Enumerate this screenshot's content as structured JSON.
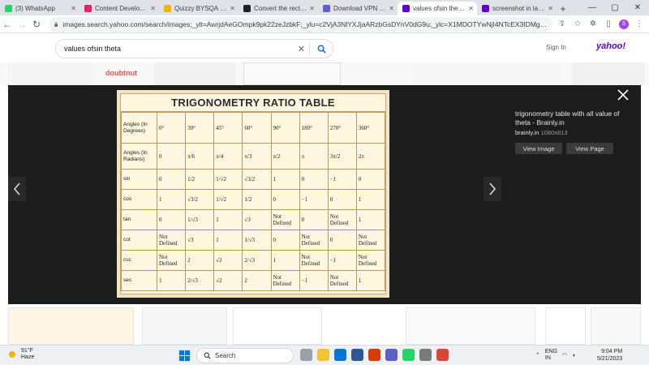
{
  "tabs": [
    {
      "title": "(3) WhatsApp",
      "color": "#25d366"
    },
    {
      "title": "Content Developer te...",
      "color": "#e91e63"
    },
    {
      "title": "Quizzy BYSQA Test Gu...",
      "color": "#f5b400"
    },
    {
      "title": "Convert the rectangul...",
      "color": "#202124"
    },
    {
      "title": "Download VPN | Prot...",
      "color": "#5b5fc7"
    },
    {
      "title": "values ofsin theta - Yo...",
      "color": "#6001d2"
    },
    {
      "title": "screenshot in laptop ...",
      "color": "#6001d2"
    }
  ],
  "browser": {
    "url": "images.search.yahoo.com/search/images;_ylt=AwrjdAeGOmpk9pk22zeJzbkF;_ylu=c2VjA3NlYXJjaARzbGsDYnV0dG9u;_ylc=X1MDOTYwNjI4NTcEX3IDMgRmcmNtYWEEZnlyA3A6cyx2OmksbTpz..."
  },
  "yahoo": {
    "search_query": "values ofsin theta",
    "sign_in": "Sign In",
    "logo": "yahoo!"
  },
  "results": {
    "doubtnut": "doubtnut"
  },
  "viewer": {
    "title": "trigonometry table with all value of theta - Brainly.in",
    "source": "brainly.in",
    "dimensions": "1080x813",
    "view_image": "View Image",
    "view_page": "View Page"
  },
  "trig_table": {
    "heading": "TRIGONOMETRY RATIO TABLE",
    "rows": [
      [
        "Angles (In Degrees)",
        "0°",
        "30°",
        "45°",
        "60°",
        "90°",
        "180°",
        "270°",
        "360°"
      ],
      [
        "Angles (In Radians)",
        "0",
        "π/6",
        "π/4",
        "π/3",
        "π/2",
        "π",
        "3π/2",
        "2π"
      ],
      [
        "sin",
        "0",
        "1/2",
        "1/√2",
        "√3/2",
        "1",
        "0",
        "−1",
        "0"
      ],
      [
        "cos",
        "1",
        "√3/2",
        "1/√2",
        "1/2",
        "0",
        "−1",
        "0",
        "1"
      ],
      [
        "tan",
        "0",
        "1/√3",
        "1",
        "√3",
        "Not Defined",
        "0",
        "Not Defined",
        "1"
      ],
      [
        "cot",
        "Not Defined",
        "√3",
        "1",
        "1/√3",
        "0",
        "Not Defined",
        "0",
        "Not Defined"
      ],
      [
        "csc",
        "Not Defined",
        "2",
        "√2",
        "2/√3",
        "1",
        "Not Defined",
        "−1",
        "Not Defined"
      ],
      [
        "sec",
        "1",
        "2/√3",
        "√2",
        "2",
        "Not Defined",
        "−1",
        "Not Defined",
        "1"
      ]
    ]
  },
  "taskbar": {
    "temp": "91°F",
    "weather": "Haze",
    "search": "Search",
    "lang": "ENG",
    "region": "IN",
    "time": "9:04 PM",
    "date": "5/21/2023"
  }
}
